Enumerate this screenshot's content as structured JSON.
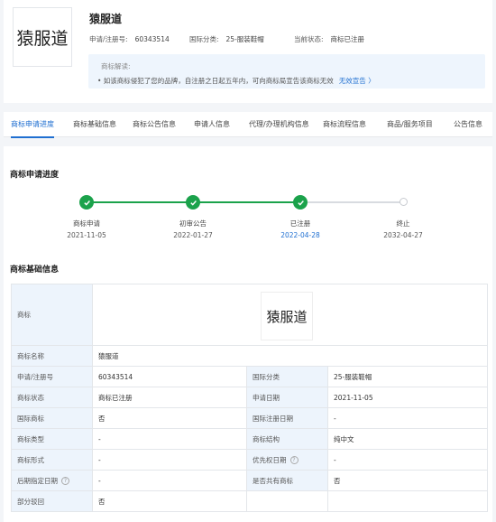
{
  "header": {
    "logo_text": "猿服道",
    "name": "猿服道",
    "reg_no_label": "申请/注册号:",
    "reg_no": "60343514",
    "class_label": "国际分类:",
    "class_value": "25-服装鞋帽",
    "status_label": "当前状态:",
    "status_value": "商标已注册",
    "notice_title": "商标解读:",
    "notice_text": "• 如该商标侵犯了您的品牌，自注册之日起五年内，可向商标局宣告该商标无效",
    "notice_link": "无效宣告 〉"
  },
  "tabs": [
    {
      "label": "商标申请进度",
      "active": true
    },
    {
      "label": "商标基础信息",
      "active": false
    },
    {
      "label": "商标公告信息",
      "active": false
    },
    {
      "label": "申请人信息",
      "active": false
    },
    {
      "label": "代理/办理机构信息",
      "active": false
    },
    {
      "label": "商标流程信息",
      "active": false
    },
    {
      "label": "商品/服务项目",
      "active": false
    },
    {
      "label": "公告信息",
      "active": false
    }
  ],
  "progress": {
    "title": "商标申请进度",
    "steps": [
      {
        "label": "商标申请",
        "date": "2021-11-05",
        "done": true
      },
      {
        "label": "初审公告",
        "date": "2022-01-27",
        "done": true
      },
      {
        "label": "已注册",
        "date": "2022-04-28",
        "done": true,
        "current": true
      },
      {
        "label": "终止",
        "date": "2032-04-27",
        "done": false
      }
    ]
  },
  "basic": {
    "title": "商标基础信息",
    "logo_label": "商标",
    "logo_text": "猿服道",
    "name_label": "商标名称",
    "name_value": "猿服道",
    "rows": [
      {
        "k1": "申请/注册号",
        "v1": "60343514",
        "k2": "国际分类",
        "v2": "25-服装鞋帽"
      },
      {
        "k1": "商标状态",
        "v1": "商标已注册",
        "k2": "申请日期",
        "v2": "2021-11-05"
      },
      {
        "k1": "国际商标",
        "v1": "否",
        "k2": "国际注册日期",
        "v2": "-"
      },
      {
        "k1": "商标类型",
        "v1": "-",
        "k2": "商标结构",
        "v2": "纯中文"
      },
      {
        "k1": "商标形式",
        "v1": "-",
        "k2": "优先权日期",
        "v2": "-"
      },
      {
        "k1": "后期指定日期",
        "v1": "-",
        "k2": "是否共有商标",
        "v2": "否"
      },
      {
        "k1": "部分驳回",
        "v1": "否",
        "k2": "",
        "v2": ""
      }
    ]
  },
  "colors": {
    "accent": "#1f6fd1",
    "done": "#1ba24b",
    "key_bg": "#edf4fc"
  }
}
